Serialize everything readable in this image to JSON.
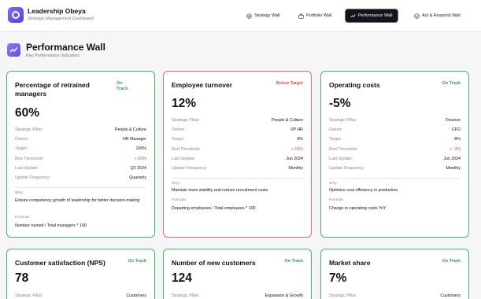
{
  "app": {
    "title": "Leadership Obeya",
    "subtitle": "Strategic Management Dashboard"
  },
  "nav": [
    {
      "label": "Strategy Wall",
      "icon": "target-icon",
      "active": false
    },
    {
      "label": "Portfolio Wall",
      "icon": "briefcase-icon",
      "active": false
    },
    {
      "label": "Performance Wall",
      "icon": "trend-up-icon",
      "active": true
    },
    {
      "label": "Act & Respond Wall",
      "icon": "circle-check-icon",
      "active": false
    }
  ],
  "page": {
    "title": "Performance Wall",
    "subtitle": "Key Performance Indicators"
  },
  "labels": {
    "pillar": "Strategic Pillar:",
    "owner": "Owner:",
    "target": "Target:",
    "threshold": "Red Threshold:",
    "last_update": "Last Update:",
    "frequency": "Update Frequency:",
    "why": "Why:",
    "formula": "Formula:"
  },
  "colors": {
    "on_track": "#2fa34c",
    "below_target": "#e04848",
    "accent": "#5b4fe6",
    "active_nav": "#14141c"
  },
  "kpis": [
    {
      "title": "Percentage of retrained managers",
      "status": "On Track",
      "status_color": "green",
      "value": "60%",
      "pillar": "People & Culture",
      "owner": "HR Manager",
      "target": "100%",
      "threshold": "< 60%",
      "last_update": "Q2 2024",
      "frequency": "Quarterly",
      "why": "Ensure competency growth of leadership for better decision-making",
      "formula": "Number trained / Total managers * 100"
    },
    {
      "title": "Employee turnover",
      "status": "Below Target",
      "status_color": "red",
      "value": "12%",
      "pillar": "People & Culture",
      "owner": "VP HR",
      "target": "8%",
      "threshold": "> 15%",
      "last_update": "Jun 2024",
      "frequency": "Monthly",
      "why": "Maintain team stability and reduce recruitment costs",
      "formula": "Departing employees / Total employees * 100"
    },
    {
      "title": "Operating costs",
      "status": "On Track",
      "status_color": "green",
      "value": "-5%",
      "pillar": "Finance",
      "owner": "CFO",
      "target": "-8%",
      "threshold": "> -3%",
      "last_update": "Jun 2024",
      "frequency": "Monthly",
      "why": "Optimize cost efficiency in production",
      "formula": "Change in operating costs YoY"
    },
    {
      "title": "Customer satisfaction (NPS)",
      "status": "On Track",
      "status_color": "green",
      "value": "78",
      "pillar": "Customers"
    },
    {
      "title": "Number of new customers",
      "status": "On Track",
      "status_color": "green",
      "value": "124",
      "pillar": "Expansion & Growth"
    },
    {
      "title": "Market share",
      "status": "On Track",
      "status_color": "green",
      "value": "7%",
      "pillar": "Customers"
    }
  ]
}
